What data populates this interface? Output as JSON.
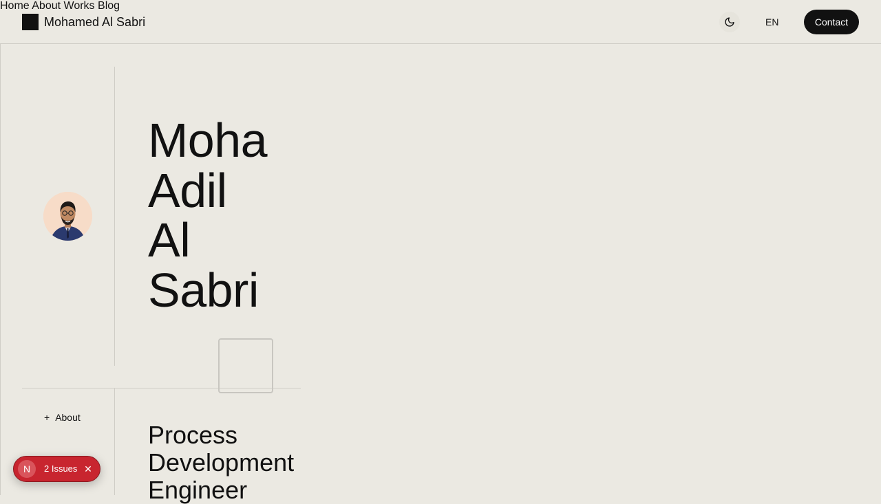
{
  "header": {
    "brand_name": "Mohamed Al Sabri",
    "nav": [
      "Home",
      "About",
      "Works",
      "Blog"
    ],
    "language": "EN",
    "contact_label": "Contact"
  },
  "hero": {
    "name_lines": [
      "Mohamed",
      "Adil",
      "Al",
      "Sabri"
    ]
  },
  "about": {
    "toggle_label": "About",
    "role_lines": [
      "Process",
      "Development",
      "Engineer"
    ]
  },
  "dev_overlay": {
    "logo": "N",
    "issues_label": "2 Issues"
  },
  "colors": {
    "background": "#ebe9e2",
    "text": "#111111",
    "contact_bg": "#111111",
    "issues_bg": "#c8252f"
  },
  "icons": {
    "theme_toggle": "moon-icon",
    "about_toggle": "plus-icon",
    "issues_close": "close-icon"
  }
}
